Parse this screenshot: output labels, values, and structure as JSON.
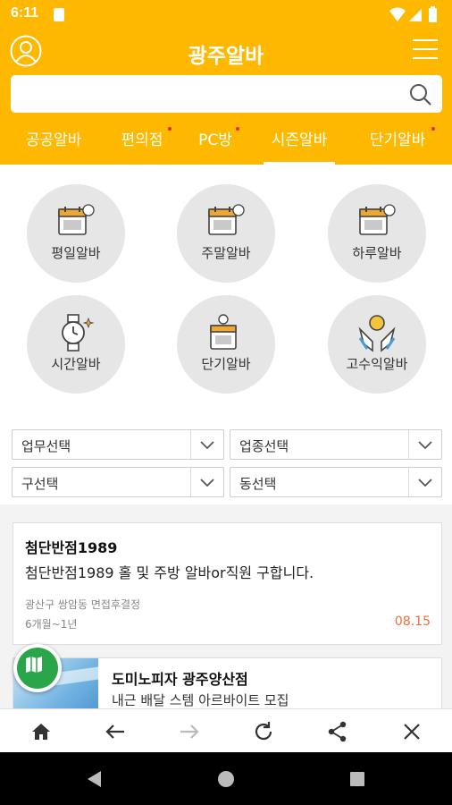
{
  "status_bar": {
    "time": "6:11"
  },
  "header": {
    "title": "광주알바",
    "search": {
      "value": "",
      "placeholder": ""
    }
  },
  "tabs": [
    {
      "label": "공공알바",
      "dot": false,
      "active": false
    },
    {
      "label": "편의점",
      "dot": true,
      "active": false
    },
    {
      "label": "PC방",
      "dot": true,
      "active": false
    },
    {
      "label": "시즌알바",
      "dot": false,
      "active": true
    },
    {
      "label": "단기알바",
      "dot": true,
      "active": false
    }
  ],
  "categories": [
    {
      "label": "평일알바",
      "icon": "weekday-calendar-icon",
      "badge": "WEEK DAY"
    },
    {
      "label": "주말알바",
      "icon": "weekend-calendar-icon",
      "badge": "WEEK END"
    },
    {
      "label": "하루알바",
      "icon": "oneday-calendar-icon",
      "badge": "ONE DAY"
    },
    {
      "label": "시간알바",
      "icon": "watch-icon"
    },
    {
      "label": "단기알바",
      "icon": "short-term-calendar-icon",
      "badge": "SHORT TERM"
    },
    {
      "label": "고수익알바",
      "icon": "money-hands-icon"
    }
  ],
  "filters": {
    "job": "업무선택",
    "industry": "업종선택",
    "district": "구선택",
    "neighborhood": "동선택"
  },
  "listings": [
    {
      "company": "첨단반점1989",
      "title": "첨단반점1989 홀 및 주방 알바or직원 구합니다.",
      "location": "광산구 쌍암동  면접후결정",
      "period": "6개월~1년",
      "date": "08.15"
    },
    {
      "company": "도미노피자 광주양산점",
      "title": "내근 배달 스템 아르바이트 모집"
    }
  ],
  "colors": {
    "brand": "#ffb800",
    "date_accent": "#f26b3a",
    "tab_dot": "#e8243a",
    "map_button": "#2aa64a"
  }
}
